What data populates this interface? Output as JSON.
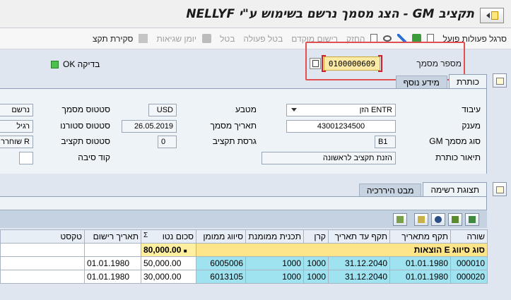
{
  "window": {
    "title": "תקציב GM - הצג מסמך נרשם בשימוש ע\"י NELLYF"
  },
  "toolbar": {
    "items": [
      {
        "label": "סרגל פעולות פועל",
        "disabled": false
      },
      {
        "label": "החזק",
        "disabled": true
      },
      {
        "label": "רישום מוקדם",
        "disabled": true
      },
      {
        "label": "בטל פעולה",
        "disabled": true
      },
      {
        "label": "בטל",
        "disabled": true
      },
      {
        "label": "יומן שגיאות",
        "disabled": true
      },
      {
        "label": "סקירת תקצ",
        "disabled": false
      }
    ]
  },
  "header": {
    "doc_number_label": "מספר מסמך",
    "doc_number": "0100000609",
    "check_label": "בדיקה OK"
  },
  "tabs_top": {
    "tab1": "כותרת",
    "tab2": "מידע נוסף"
  },
  "form": {
    "processing_label": "עיבוד",
    "processing_value": "ENTR הזן",
    "grantor_label": "מענק",
    "grantor_value": "43001234500",
    "doc_type_label": "סוג מסמך GM",
    "doc_type_value": "B1",
    "header_desc_label": "תיאור כותרת",
    "header_desc_value": "הזנת תקציב לראשונה",
    "currency_label": "מטבע",
    "currency_value": "USD",
    "doc_date_label": "תאריך מסמך",
    "doc_date_value": "26.05.2019",
    "budget_version_label": "גרסת תקציב",
    "budget_version_value": "0",
    "doc_status_label": "סטטוס מסמך",
    "doc_status_value": "נרשם",
    "reversal_status_label": "סטטוס סטורנו",
    "reversal_status_value": "רגיל",
    "budget_status_label": "סטטוס תקציב",
    "budget_status_value": "R שוחרר",
    "reason_code_label": "קוד סיבה",
    "reason_code_value": ""
  },
  "tabs_bottom": {
    "tab1": "תצוגת רשימה",
    "tab2": "מבט היררכיה"
  },
  "table": {
    "columns": [
      "שורה",
      "תקף מתאריך",
      "תקף עד תאריך",
      "קרן",
      "תכנית ממומנת",
      "סיווג ממומן",
      "סכום נטו",
      "תאריך רישום",
      "טקסט"
    ],
    "sum_symbol": "Σ",
    "group_label": "סוג סיווג E הוצאות",
    "group_total": "80,000.00",
    "group_total_marker": "■",
    "rows": [
      {
        "line": "000010",
        "valid_from": "01.01.1980",
        "valid_to": "31.12.2040",
        "fund": "1000",
        "program": "1000",
        "sponsored_class": "6005006",
        "net_amount": "50,000.00",
        "posting_date": "01.01.1980",
        "text": ""
      },
      {
        "line": "000020",
        "valid_from": "01.01.1980",
        "valid_to": "31.12.2040",
        "fund": "1000",
        "program": "1000",
        "sponsored_class": "6013105",
        "net_amount": "30,000.00",
        "posting_date": "01.01.1980",
        "text": ""
      }
    ]
  }
}
